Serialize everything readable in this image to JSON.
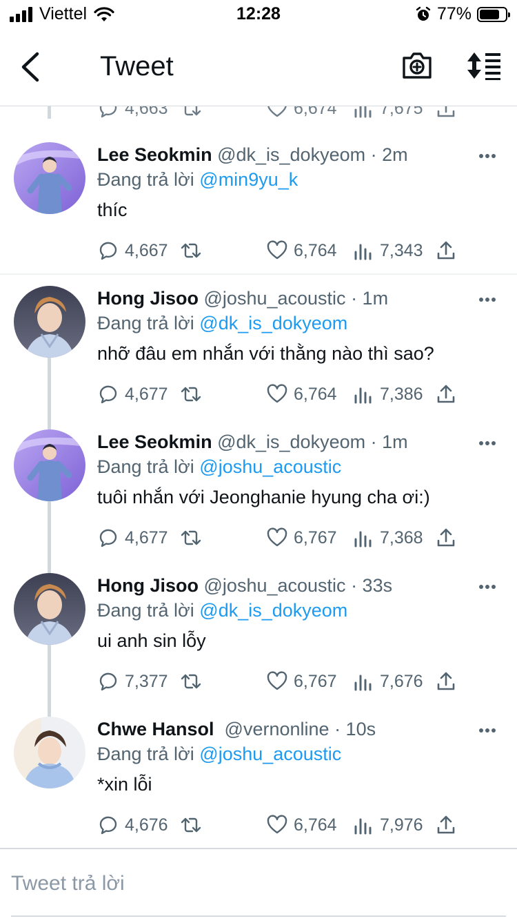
{
  "status_bar": {
    "carrier": "Viettel",
    "time": "12:28",
    "battery": "77%",
    "battery_level": 0.77
  },
  "header": {
    "title": "Tweet"
  },
  "partial_actions": {
    "replies": "4,663",
    "likes": "6,674",
    "views": "7,675"
  },
  "tweets": [
    {
      "name": "Lee Seokmin",
      "handle": "@dk_is_dokyeom",
      "time": "· 2m",
      "reply_prefix": "Đang trả lời",
      "reply_to": "@min9yu_k",
      "text": "thíc",
      "replies": "4,667",
      "likes": "6,764",
      "views": "7,343"
    },
    {
      "name": "Hong Jisoo",
      "handle": "@joshu_acoustic",
      "time": "· 1m",
      "reply_prefix": "Đang trả lời",
      "reply_to": "@dk_is_dokyeom",
      "text": "nhỡ đâu em nhắn với thằng nào thì sao?",
      "replies": "4,677",
      "likes": "6,764",
      "views": "7,386"
    },
    {
      "name": "Lee Seokmin",
      "handle": "@dk_is_dokyeom",
      "time": "· 1m",
      "reply_prefix": "Đang trả lời",
      "reply_to": "@joshu_acoustic",
      "text": "tuôi nhắn với Jeonghanie hyung cha ơi:)",
      "replies": "4,677",
      "likes": "6,767",
      "views": "7,368"
    },
    {
      "name": "Hong Jisoo",
      "handle": "@joshu_acoustic",
      "time": "· 33s",
      "reply_prefix": "Đang trả lời",
      "reply_to": "@dk_is_dokyeom",
      "text": "ui anh sin lỗy",
      "replies": "7,377",
      "likes": "6,767",
      "views": "7,676"
    },
    {
      "name": "Chwe Hansol",
      "handle": "@vernonline",
      "time": "· 10s",
      "reply_prefix": "Đang trả lời",
      "reply_to": "@joshu_acoustic",
      "text": "*xin lỗi",
      "replies": "4,676",
      "likes": "6,764",
      "views": "7,976"
    }
  ],
  "reply_bar": {
    "placeholder": "Tweet trả lời"
  },
  "colors": {
    "accent": "#1d9bf0",
    "secondary_text": "#536471",
    "primary_text": "#0f1419",
    "thread_line": "#cfd9de"
  }
}
